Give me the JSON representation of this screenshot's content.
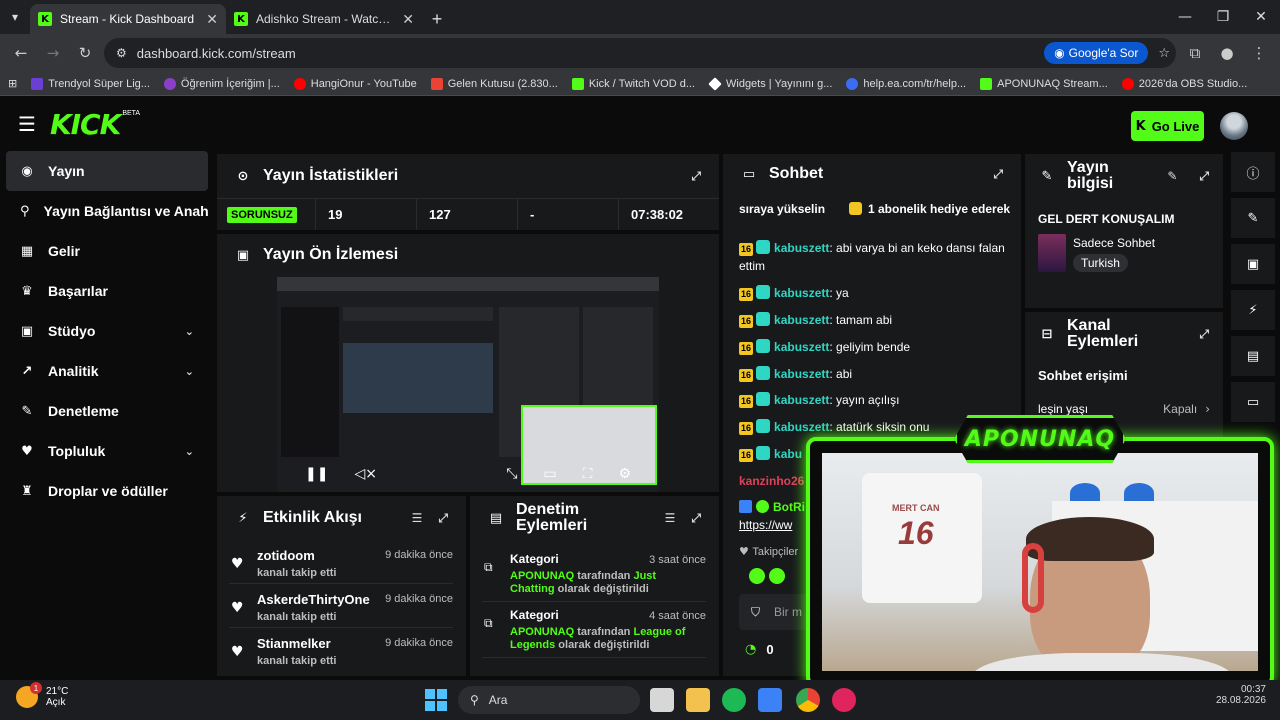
{
  "browser": {
    "tabs": [
      {
        "title": "Stream - Kick Dashboard"
      },
      {
        "title": "Adishko Stream - Watch Live on Kick"
      }
    ],
    "url": "dashboard.kick.com/stream",
    "google_ask": "Google'a Sor",
    "bookmarks": [
      {
        "label": "Trendyol Süper Lig...",
        "color": "#6b3fd4"
      },
      {
        "label": "Öğrenim İçeriğim |...",
        "color": "#8b3fc8"
      },
      {
        "label": "HangiOnur - YouTube",
        "color": "#ff0000"
      },
      {
        "label": "Gelen Kutusu (2.830...",
        "color": "#ea4335"
      },
      {
        "label": "Kick / Twitch VOD d...",
        "color": "#53fc18"
      },
      {
        "label": "Widgets | Yayınını g...",
        "color": "#ffffff"
      },
      {
        "label": "help.ea.com/tr/help...",
        "color": "#3b6df0"
      },
      {
        "label": "APONUNAQ Stream...",
        "color": "#53fc18"
      },
      {
        "label": "2026'da OBS Studio...",
        "color": "#ff0000"
      }
    ]
  },
  "app": {
    "logo": "KICK",
    "beta": "BETA",
    "go_live": "Go Live",
    "accent": "#53fc18"
  },
  "sidebar": {
    "items": [
      {
        "label": "Yayın",
        "icon": "radio-icon"
      },
      {
        "label": "Yayın Bağlantısı ve Anahtarı",
        "icon": "link-icon"
      },
      {
        "label": "Gelir",
        "icon": "revenue-icon"
      },
      {
        "label": "Başarılar",
        "icon": "trophy-icon"
      },
      {
        "label": "Stüdyo",
        "icon": "studio-icon"
      },
      {
        "label": "Analitik",
        "icon": "analytics-icon"
      },
      {
        "label": "Denetleme",
        "icon": "wrench-icon"
      },
      {
        "label": "Topluluk",
        "icon": "community-icon"
      },
      {
        "label": "Droplar ve ödüller",
        "icon": "gift-icon"
      }
    ]
  },
  "stats": {
    "title": "Yayın İstatistikleri",
    "status": "SORUNSUZ",
    "viewers": "19",
    "followers": "127",
    "other": "-",
    "duration": "07:38:02"
  },
  "preview": {
    "title": "Yayın Ön İzlemesi"
  },
  "activity": {
    "title": "Etkinlik Akışı",
    "items": [
      {
        "name": "zotidoom",
        "sub": "kanalı takip etti",
        "time": "9 dakika önce"
      },
      {
        "name": "AskerdeThirtyOne",
        "sub": "kanalı takip etti",
        "time": "9 dakika önce"
      },
      {
        "name": "Stianmelker",
        "sub": "kanalı takip etti",
        "time": "9 dakika önce"
      }
    ]
  },
  "moderation": {
    "title": "Denetim Eylemleri",
    "items": [
      {
        "category": "Kategori",
        "time": "3 saat önce",
        "user": "APONUNAQ",
        "mid": " tarafından ",
        "value": "Just Chatting",
        "end": " olarak değiştirildi"
      },
      {
        "category": "Kategori",
        "time": "4 saat önce",
        "user": "APONUNAQ",
        "mid": " tarafından ",
        "value": "League of Legends",
        "end": " olarak değiştirildi"
      }
    ]
  },
  "chat": {
    "title": "Sohbet",
    "top_left": "sıraya yükselin",
    "top_right": "1 abonelik hediye ederek",
    "messages": [
      {
        "badge": "16",
        "user": "kabuszett",
        "text": ": abi varya bi an keko dansı falan ettim"
      },
      {
        "badge": "16",
        "user": "kabuszett",
        "text": ": ya"
      },
      {
        "badge": "16",
        "user": "kabuszett",
        "text": ": tamam abi"
      },
      {
        "badge": "16",
        "user": "kabuszett",
        "text": ": geliyim bende"
      },
      {
        "badge": "16",
        "user": "kabuszett",
        "text": ": abi"
      },
      {
        "badge": "16",
        "user": "kabuszett",
        "text": ": yayın açılışı"
      },
      {
        "badge": "16",
        "user": "kabuszett",
        "text": ": atatürk siksin onu"
      }
    ],
    "partial_user": "kabu",
    "red_user": "kanzinho26",
    "bot_user": "BotRi",
    "bot_link": "https://ww",
    "followers_label": "Takipçiler",
    "input_placeholder": "Bir m",
    "count": "0"
  },
  "info": {
    "title": "Yayın bilgisi",
    "stream_title": "GEL DERT KONUŞALIM",
    "category": "Sadece Sohbet",
    "language": "Turkish"
  },
  "channel_actions": {
    "title": "Kanal Eylemleri",
    "chat_access": "Sohbet erişimi",
    "age_label": "leşin yaşı",
    "age_value": "Kapalı"
  },
  "webcam": {
    "label": "APONUNAQ",
    "jersey": "16",
    "jersey_name": "MERT CAN"
  },
  "taskbar": {
    "temp": "21°C",
    "weather": "Açık",
    "weather_badge": "1",
    "search": "Ara",
    "time": "00:37",
    "date": "28.08.2026"
  }
}
